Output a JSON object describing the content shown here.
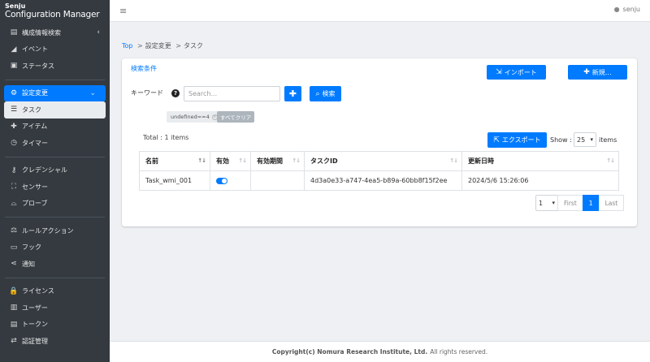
{
  "brand": {
    "line1": "Senju",
    "line2": "Configuration Manager"
  },
  "sidebar": {
    "groups": [
      [
        {
          "label": "構成情報検索",
          "icon": "cmdb-icon",
          "glyph": "▤",
          "chevron": "‹"
        },
        {
          "label": "イベント",
          "icon": "event-icon",
          "glyph": "◢"
        },
        {
          "label": "ステータス",
          "icon": "status-icon",
          "glyph": "▣"
        }
      ],
      [
        {
          "label": "設定変更",
          "icon": "settings-change-icon",
          "glyph": "⚙",
          "chevron": "⌄",
          "active": true
        },
        {
          "label": "タスク",
          "icon": "task-icon",
          "glyph": "☰",
          "sub_active": true
        },
        {
          "label": "アイテム",
          "icon": "puzzle-icon",
          "glyph": "✚"
        },
        {
          "label": "タイマー",
          "icon": "clock-icon",
          "glyph": "◷"
        }
      ],
      [
        {
          "label": "クレデンシャル",
          "icon": "key-icon",
          "glyph": "⚷"
        },
        {
          "label": "センサー",
          "icon": "sensor-icon",
          "glyph": "⛶"
        },
        {
          "label": "プローブ",
          "icon": "probe-icon",
          "glyph": "⌓"
        }
      ],
      [
        {
          "label": "ルールアクション",
          "icon": "rule-icon",
          "glyph": "⚖"
        },
        {
          "label": "フック",
          "icon": "terminal-icon",
          "glyph": "▭"
        },
        {
          "label": "通知",
          "icon": "share-icon",
          "glyph": "⋖"
        }
      ],
      [
        {
          "label": "ライセンス",
          "icon": "lock-icon",
          "glyph": "🔒"
        },
        {
          "label": "ユーザー",
          "icon": "user-book-icon",
          "glyph": "▥"
        },
        {
          "label": "トークン",
          "icon": "token-icon",
          "glyph": "▤"
        },
        {
          "label": "認証管理",
          "icon": "exchange-icon",
          "glyph": "⇄"
        }
      ]
    ]
  },
  "header": {
    "user": "senju"
  },
  "breadcrumb": {
    "top": "Top",
    "sep": ">",
    "level1": "設定変更",
    "level2": "タスク"
  },
  "search_panel": {
    "title": "検索条件",
    "import_label": "インポート",
    "new_label": "新規…",
    "keyword_label": "キーワード",
    "search_placeholder": "Search...",
    "search_button": "検索",
    "tag": "undefined==4",
    "clear_all": "すべてクリア"
  },
  "list": {
    "total": "Total : 1 items",
    "export_label": "エクスポート",
    "show_label": "Show :",
    "page_size": "25",
    "items_label": "items",
    "columns": [
      "名前",
      "有効",
      "有効期間",
      "タスクID",
      "更新日時"
    ],
    "rows": [
      {
        "name": "Task_wmi_001",
        "enabled": true,
        "period": "",
        "task_id": "4d3a0e33-a747-4ea5-b89a-60bb8f15f2ee",
        "updated": "2024/5/6 15:26:06"
      }
    ]
  },
  "pager": {
    "select": "1",
    "first": "First",
    "page": "1",
    "last": "Last"
  },
  "footer": {
    "bold": "Copyright(c) Nomura Research Institute, Ltd.",
    "rest": "All rights reserved."
  },
  "colors": {
    "primary": "#007bff",
    "sidebar_bg": "#343a40"
  }
}
